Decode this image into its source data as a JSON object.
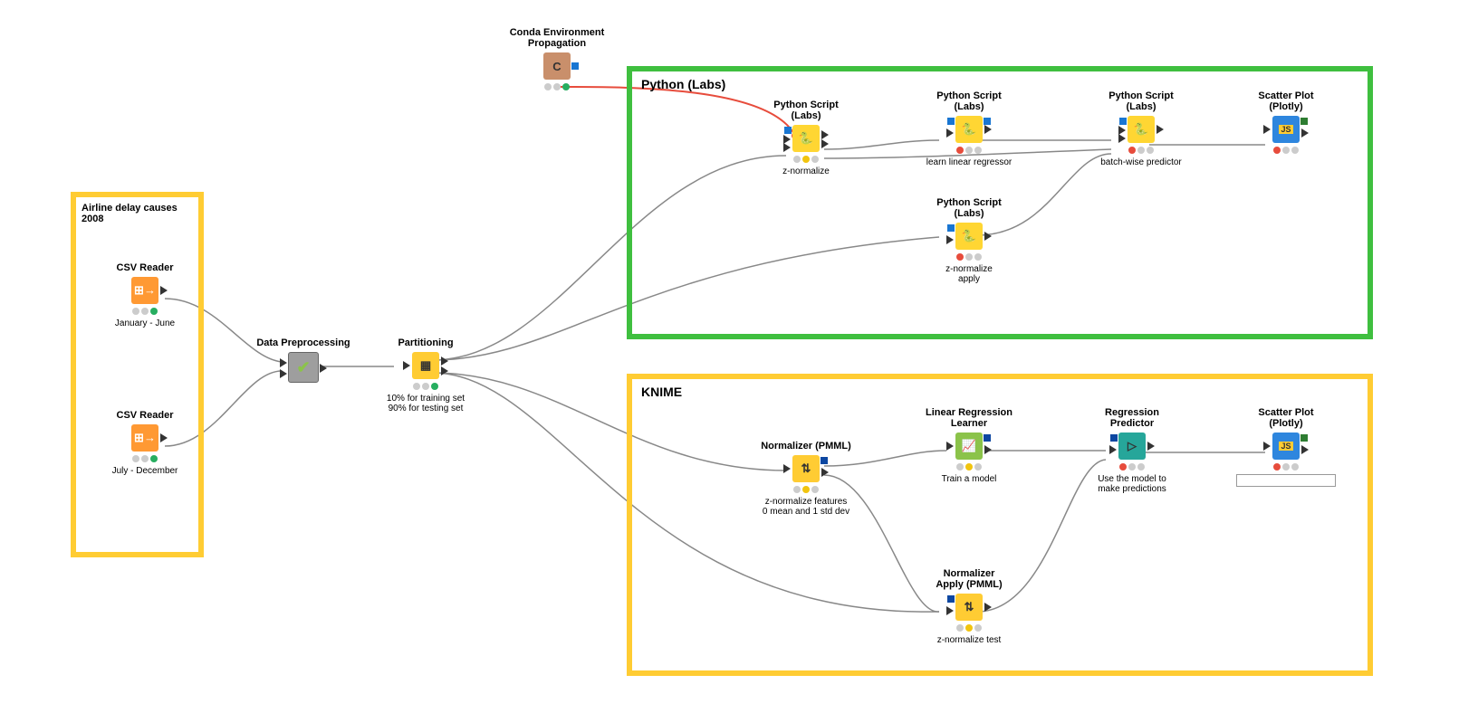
{
  "regions": {
    "airline": {
      "title": "Airline delay causes 2008",
      "color": "#ffcc33"
    },
    "python": {
      "title": "Python (Labs)",
      "color": "#4caf50"
    },
    "knime": {
      "title": "KNIME",
      "color": "#ffcc33"
    }
  },
  "nodes": {
    "conda": {
      "title": "Conda Environment\nPropagation",
      "subtitle": ""
    },
    "csv1": {
      "title": "CSV Reader",
      "subtitle": "January - June"
    },
    "csv2": {
      "title": "CSV Reader",
      "subtitle": "July - December"
    },
    "preproc": {
      "title": "Data Preprocessing",
      "subtitle": ""
    },
    "partition": {
      "title": "Partitioning",
      "subtitle": "10% for training set\n90% for testing set"
    },
    "py_znorm": {
      "title": "Python Script\n(Labs)",
      "subtitle": "z-normalize"
    },
    "py_znorm_apply": {
      "title": "Python Script\n(Labs)",
      "subtitle": "z-normalize\napply"
    },
    "py_linreg": {
      "title": "Python Script\n(Labs)",
      "subtitle": "learn linear regressor"
    },
    "py_batch": {
      "title": "Python Script\n(Labs)",
      "subtitle": "batch-wise predictor"
    },
    "scatter1": {
      "title": "Scatter Plot\n(Plotly)",
      "subtitle": ""
    },
    "norm_pmml": {
      "title": "Normalizer (PMML)",
      "subtitle": "z-normalize features\n0 mean and 1  std dev"
    },
    "norm_apply": {
      "title": "Normalizer\nApply (PMML)",
      "subtitle": "z-normalize test"
    },
    "linreg_learner": {
      "title": "Linear Regression\nLearner",
      "subtitle": "Train a model"
    },
    "reg_pred": {
      "title": "Regression\nPredictor",
      "subtitle": "Use the model to\nmake predictions"
    },
    "scatter2": {
      "title": "Scatter Plot\n(Plotly)",
      "subtitle": ""
    }
  }
}
